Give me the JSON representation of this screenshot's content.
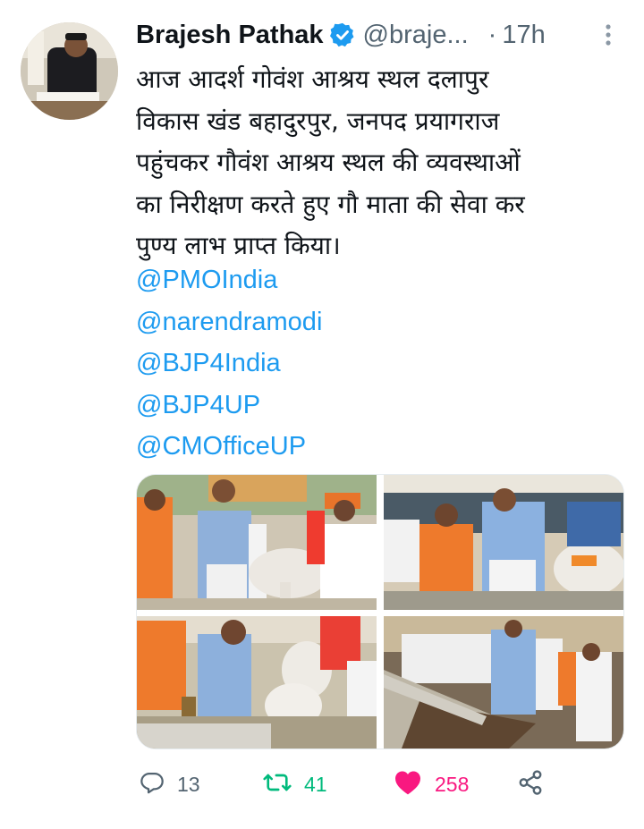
{
  "tweet": {
    "author_name": "Brajesh Pathak",
    "handle": "@braje...",
    "separator": "·",
    "time": "17h",
    "text_lines": [
      "आज आदर्श गोवंश आश्रय स्थल दलापुर",
      "विकास खंड बहादुरपुर, जनपद प्रयागराज",
      "पहुंचकर गौवंश आश्रय स्थल की व्यवस्थाओं",
      "का निरीक्षण करते हुए गौ माता की सेवा कर",
      "पुण्य लाभ प्राप्त किया।"
    ],
    "mentions": [
      "@PMOIndia",
      "@narendramodi",
      "@BJP4India",
      "@BJP4UP",
      "@CMOfficeUP"
    ]
  },
  "actions": {
    "reply_count": "13",
    "retweet_count": "41",
    "like_count": "258"
  },
  "icons": {
    "verified": "verified-badge-icon",
    "more": "more-options-icon",
    "reply": "reply-icon",
    "retweet": "retweet-icon",
    "like": "heart-icon",
    "share": "share-icon"
  },
  "colors": {
    "link": "#1d9bf0",
    "retweet": "#00ba7c",
    "like": "#f91880",
    "secondary_text": "#536471",
    "primary_text": "#0f1419"
  }
}
